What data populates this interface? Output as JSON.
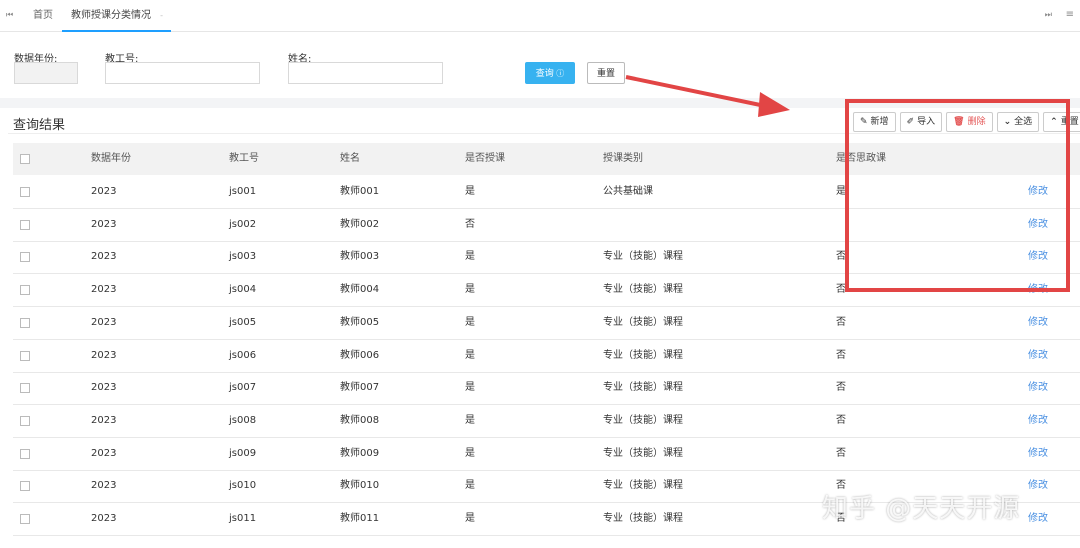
{
  "tabs": {
    "home": "首页",
    "active": "教师授课分类情况",
    "close_glyph": "-"
  },
  "form": {
    "year_label": "数据年份:",
    "year_value": "",
    "staff_id_label": "教工号:",
    "staff_id_value": "",
    "name_label": "姓名:",
    "name_value": "",
    "query_label": "查询",
    "reset_label": "重置"
  },
  "result": {
    "title": "查询结果",
    "toolbar": {
      "add": "新增",
      "import": "导入",
      "delete": "删除",
      "select_all": "全选",
      "reset": "重置"
    }
  },
  "table": {
    "headers": [
      "数据年份",
      "教工号",
      "姓名",
      "是否授课",
      "授课类别",
      "是否思政课"
    ],
    "edit_label": "修改",
    "rows": [
      {
        "year": "2023",
        "id": "js001",
        "name": "教师001",
        "teach": "是",
        "type": "公共基础课",
        "ideo": "是"
      },
      {
        "year": "2023",
        "id": "js002",
        "name": "教师002",
        "teach": "否",
        "type": "",
        "ideo": ""
      },
      {
        "year": "2023",
        "id": "js003",
        "name": "教师003",
        "teach": "是",
        "type": "专业（技能）课程",
        "ideo": "否"
      },
      {
        "year": "2023",
        "id": "js004",
        "name": "教师004",
        "teach": "是",
        "type": "专业（技能）课程",
        "ideo": "否"
      },
      {
        "year": "2023",
        "id": "js005",
        "name": "教师005",
        "teach": "是",
        "type": "专业（技能）课程",
        "ideo": "否"
      },
      {
        "year": "2023",
        "id": "js006",
        "name": "教师006",
        "teach": "是",
        "type": "专业（技能）课程",
        "ideo": "否"
      },
      {
        "year": "2023",
        "id": "js007",
        "name": "教师007",
        "teach": "是",
        "type": "专业（技能）课程",
        "ideo": "否"
      },
      {
        "year": "2023",
        "id": "js008",
        "name": "教师008",
        "teach": "是",
        "type": "专业（技能）课程",
        "ideo": "否"
      },
      {
        "year": "2023",
        "id": "js009",
        "name": "教师009",
        "teach": "是",
        "type": "专业（技能）课程",
        "ideo": "否"
      },
      {
        "year": "2023",
        "id": "js010",
        "name": "教师010",
        "teach": "是",
        "type": "专业（技能）课程",
        "ideo": "否"
      },
      {
        "year": "2023",
        "id": "js011",
        "name": "教师011",
        "teach": "是",
        "type": "专业（技能）课程",
        "ideo": "否"
      }
    ]
  },
  "watermark": "知乎 @天天开源",
  "colors": {
    "accent": "#37b2f0",
    "annotation": "#e24545",
    "link": "#4a90e2"
  }
}
